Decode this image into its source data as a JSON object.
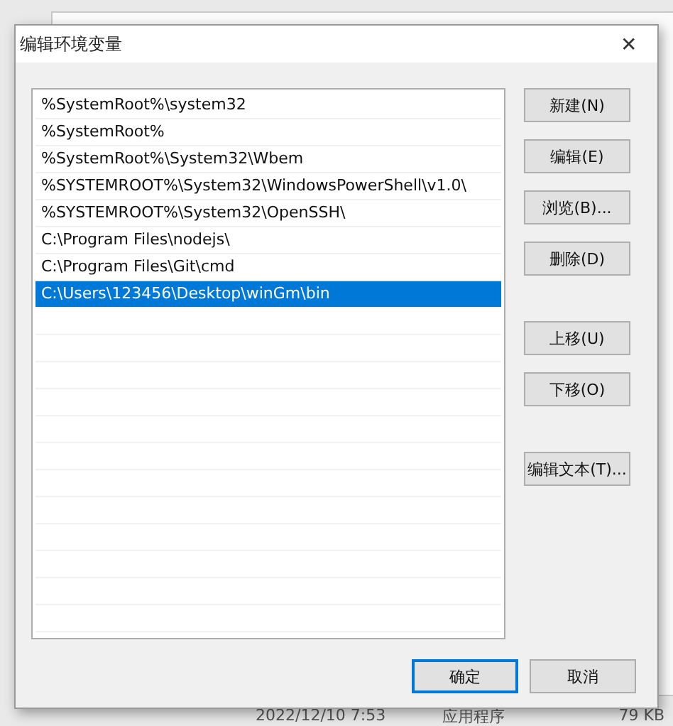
{
  "dialog": {
    "title": "编辑环境变量",
    "close": "✕"
  },
  "paths": [
    {
      "text": "%SystemRoot%\\system32",
      "selected": false
    },
    {
      "text": "%SystemRoot%",
      "selected": false
    },
    {
      "text": "%SystemRoot%\\System32\\Wbem",
      "selected": false
    },
    {
      "text": "%SYSTEMROOT%\\System32\\WindowsPowerShell\\v1.0\\",
      "selected": false
    },
    {
      "text": "%SYSTEMROOT%\\System32\\OpenSSH\\",
      "selected": false
    },
    {
      "text": "C:\\Program Files\\nodejs\\",
      "selected": false
    },
    {
      "text": "C:\\Program Files\\Git\\cmd",
      "selected": false
    },
    {
      "text": "C:\\Users\\123456\\Desktop\\winGm\\bin",
      "selected": true
    }
  ],
  "side_button_groups": [
    [
      "新建(N)",
      "编辑(E)",
      "浏览(B)...",
      "删除(D)"
    ],
    [
      "上移(U)",
      "下移(O)"
    ],
    [
      "编辑文本(T)..."
    ]
  ],
  "footer_buttons": [
    {
      "label": "确定",
      "default": true
    },
    {
      "label": "取消",
      "default": false
    }
  ],
  "background": {
    "date": "2022/12/10 7:53",
    "type": "应用程序",
    "size": "79 KB"
  }
}
